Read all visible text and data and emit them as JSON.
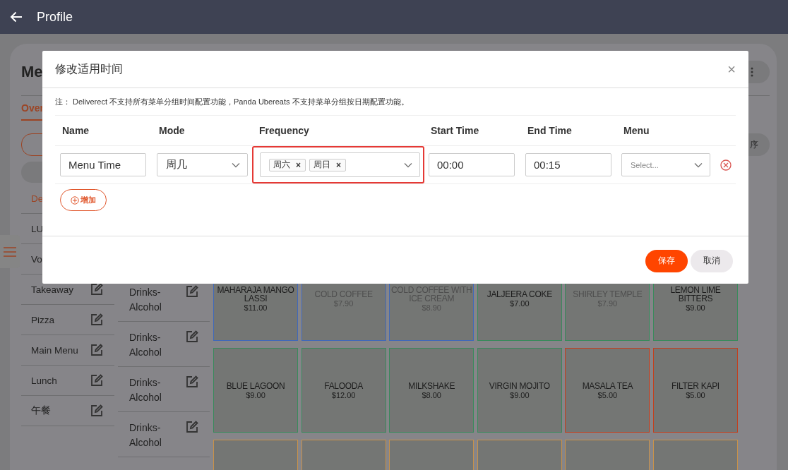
{
  "header": {
    "title": "Profile"
  },
  "page": {
    "title": "Me",
    "tabs": [
      {
        "label": "Over",
        "selected": true
      }
    ],
    "sort_button": "序"
  },
  "menus": [
    {
      "name": "De",
      "selected": true
    },
    {
      "name": "LU",
      "selected": false
    },
    {
      "name": "Vo",
      "selected": false
    },
    {
      "name": "Takeaway",
      "selected": false,
      "editable": true
    },
    {
      "name": "Pizza",
      "selected": false,
      "editable": true
    },
    {
      "name": "Main Menu",
      "selected": false,
      "editable": true
    },
    {
      "name": "Lunch",
      "selected": false,
      "editable": true
    },
    {
      "name": "午餐",
      "selected": false,
      "editable": true
    }
  ],
  "categories": [
    {
      "name": "Drinks-Alcohol"
    },
    {
      "name": "Drinks-Alcohol"
    },
    {
      "name": "Drinks-Alcohol"
    },
    {
      "name": "Drinks-Alcohol"
    }
  ],
  "items": [
    {
      "name": "MAHARAJA MANGO LASSI",
      "price": "$11.00",
      "color": "#4169b8",
      "available": true
    },
    {
      "name": "COLD COFFEE",
      "price": "$7.90",
      "color": "#4169b8",
      "available": false
    },
    {
      "name": "COLD COFFEE WITH ICE CREAM",
      "price": "$8.90",
      "color": "#4169b8",
      "available": false
    },
    {
      "name": "JALJEERA COKE",
      "price": "$7.00",
      "color": "#3a8a5c",
      "available": true
    },
    {
      "name": "SHIRLEY TEMPLE",
      "price": "$7.90",
      "color": "#3a8a5c",
      "available": false
    },
    {
      "name": "LEMON LIME BITTERS",
      "price": "$9.00",
      "color": "#3a8a5c",
      "available": true
    },
    {
      "name": "BLUE LAGOON",
      "price": "$9.00",
      "color": "#3a8a5c",
      "available": true
    },
    {
      "name": "FALOODA",
      "price": "$12.00",
      "color": "#3a8a5c",
      "available": true
    },
    {
      "name": "MILKSHAKE",
      "price": "$8.00",
      "color": "#3a8a5c",
      "available": true
    },
    {
      "name": "VIRGIN MOJITO",
      "price": "$9.00",
      "color": "#3a8a5c",
      "available": true
    },
    {
      "name": "MASALA TEA",
      "price": "$5.00",
      "color": "#c2401e",
      "available": true
    },
    {
      "name": "FILTER KAPI",
      "price": "$5.00",
      "color": "#c2401e",
      "available": true
    },
    {
      "color": "#c8924a"
    },
    {
      "color": "#c8924a"
    },
    {
      "color": "#c8924a"
    },
    {
      "color": "#c8924a"
    },
    {
      "color": "#c8924a"
    },
    {
      "color": "#c8924a"
    }
  ],
  "dialog": {
    "title": "修改适用时间",
    "close": "×",
    "remove_tag": "×",
    "note": "注： Deliverect 不支持所有菜单分组时间配置功能，Panda Ubereats 不支持菜单分组按日期配置功能。",
    "columns": [
      "Name",
      "Mode",
      "Frequency",
      "Start Time",
      "End Time",
      "Menu"
    ],
    "rows": [
      {
        "name": "Menu Time",
        "mode": "周几",
        "frequency": [
          "周六",
          "周日"
        ],
        "frequency_highlighted": true,
        "start_time": "00:00",
        "end_time": "00:15",
        "menu_placeholder": "Select..."
      }
    ],
    "add_button": "增加",
    "buttons": [
      {
        "label": "保存",
        "kind": "primary"
      },
      {
        "label": "取消",
        "kind": "secondary"
      }
    ]
  }
}
